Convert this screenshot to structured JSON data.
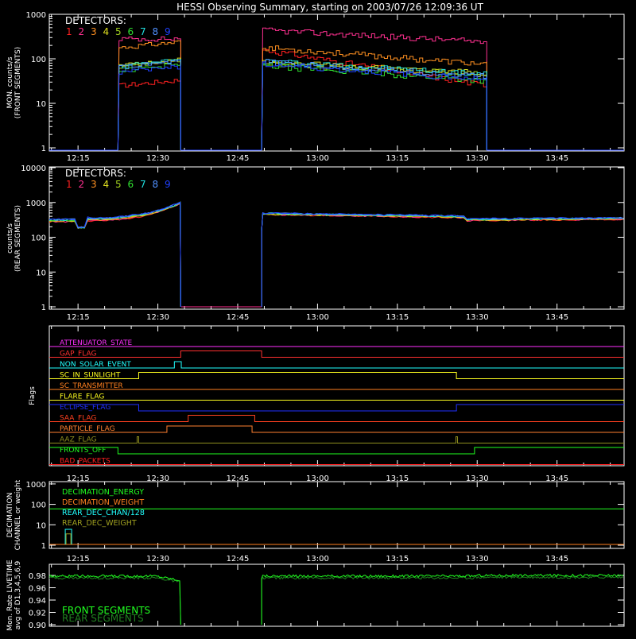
{
  "title": "HESSI Observing Summary, starting on 2003/07/26 12:09:36 UT",
  "x_tick_labels": [
    "12:15",
    "12:30",
    "12:45",
    "13:00",
    "13:15",
    "13:30",
    "13:45"
  ],
  "detectors": {
    "label": "DETECTORS:",
    "numbers": [
      "1",
      "2",
      "3",
      "4",
      "5",
      "6",
      "7",
      "8",
      "9"
    ],
    "colors": [
      "#ff2020",
      "#ff3090",
      "#ff9020",
      "#e0e020",
      "#a0d020",
      "#30e030",
      "#20e0e0",
      "#5090ff",
      "#2040ff"
    ]
  },
  "panels": {
    "front": {
      "ylabel_1": "MON. counts/s",
      "ylabel_2": "(FRONT SEGMENTS)",
      "y_ticks": [
        "1",
        "10",
        "100",
        "1000"
      ]
    },
    "rear": {
      "ylabel_1": "counts/s",
      "ylabel_2": "(REAR SEGMENTS)",
      "y_ticks": [
        "1",
        "10",
        "100",
        "1000",
        "10000"
      ]
    },
    "flags": {
      "ylabel": "Flags"
    },
    "decimation": {
      "ylabel_1": "DECIMATION",
      "ylabel_2": "CHANNEL or weight",
      "y_ticks": [
        "1",
        "10",
        "100",
        "1000"
      ]
    },
    "livetime": {
      "ylabel_1": "Mon. Rate LIVETIME",
      "ylabel_2": "avg of D1,3,4,5,6,9",
      "y_ticks": [
        "0.90",
        "0.92",
        "0.94",
        "0.96",
        "0.98"
      ]
    }
  },
  "chart_data": [
    {
      "type": "line",
      "name": "front",
      "ylim": [
        1,
        1000
      ],
      "yscale": "log",
      "x_range_min": [
        0,
        108
      ],
      "segments": [
        {
          "start": 12.9,
          "end": 24.7
        },
        {
          "start": 39.9,
          "end": 82.2
        }
      ],
      "series": [
        {
          "start_values": [
            25,
            280,
            180,
            70,
            70,
            55,
            70,
            65,
            50
          ],
          "end_values": [
            25,
            240,
            75,
            48,
            45,
            32,
            45,
            40,
            35
          ],
          "second_start": [
            160,
            440,
            180,
            85,
            80,
            70,
            90,
            85,
            75
          ]
        }
      ]
    },
    {
      "type": "line",
      "name": "rear",
      "ylim": [
        1,
        10000
      ],
      "yscale": "log",
      "x_range_min": [
        0,
        108
      ],
      "segments": [
        {
          "start": 0,
          "end": 24.7
        },
        {
          "start": 39.9,
          "end": 108
        }
      ]
    },
    {
      "type": "line",
      "name": "flags",
      "flags": [
        {
          "label": "ATTENUATOR_STATE",
          "color": "#ff30ff",
          "steps": []
        },
        {
          "label": "GAP_FLAG",
          "color": "#ff3030",
          "steps": [
            [
              24.7,
              39.9
            ]
          ]
        },
        {
          "label": "NON_SOLAR_EVENT",
          "color": "#20ffff",
          "steps": [
            [
              23.5,
              24.8
            ]
          ]
        },
        {
          "label": "SC_IN_SUNLIGHT",
          "color": "#ffff20",
          "steps": [
            [
              16.8,
              76.5
            ]
          ]
        },
        {
          "label": "SC_TRANSMITTER",
          "color": "#ff8020",
          "steps": []
        },
        {
          "label": "FLARE_FLAG",
          "color": "#ffff20",
          "steps": []
        },
        {
          "label": "ECLIPSE_FLAG",
          "color": "#2030ff",
          "steps": [
            [
              0,
              16.8
            ],
            [
              76.5,
              108
            ]
          ]
        },
        {
          "label": "SAA_FLAG",
          "color": "#ff4020",
          "steps": [
            [
              26.1,
              38.6
            ]
          ]
        },
        {
          "label": "PARTICLE_FLAG",
          "color": "#ff8030",
          "steps": [
            [
              22.1,
              38.1
            ]
          ]
        },
        {
          "label": "AAZ_FLAG",
          "color": "#909020",
          "steps": [
            [
              16.5,
              16.8
            ],
            [
              76.4,
              76.7
            ]
          ]
        },
        {
          "label": "FRONTS_OFF",
          "color": "#20ff20",
          "steps": [
            [
              0,
              12.9
            ],
            [
              79.9,
              108
            ]
          ]
        },
        {
          "label": "BAD_PACKETS",
          "color": "#ff2020",
          "steps": []
        }
      ]
    },
    {
      "type": "line",
      "name": "decimation",
      "ylim": [
        1,
        1000
      ],
      "yscale": "log",
      "legend": [
        {
          "label": "DECIMATION_ENERGY",
          "color": "#20ff20"
        },
        {
          "label": "DECIMATION_WEIGHT",
          "color": "#ff8020"
        },
        {
          "label": "REAR_DEC_CHAN/128",
          "color": "#20ffff"
        },
        {
          "label": "REAR_DEC_WEIGHT",
          "color": "#a0a020"
        }
      ],
      "energy_value": 60,
      "weight_value": 1,
      "rear_chan_pulse": {
        "start": 3,
        "end": 4.2,
        "value": 6
      }
    },
    {
      "type": "line",
      "name": "livetime",
      "ylim": [
        0.9,
        0.99
      ],
      "legend": [
        {
          "label": "FRONT SEGMENTS",
          "color": "#20ff20"
        },
        {
          "label": "REAR SEGMENTS",
          "color": "#208020"
        }
      ],
      "front_level": 0.979,
      "rear_level": 0.976,
      "drop_at": [
        24.7,
        39.9
      ]
    }
  ]
}
